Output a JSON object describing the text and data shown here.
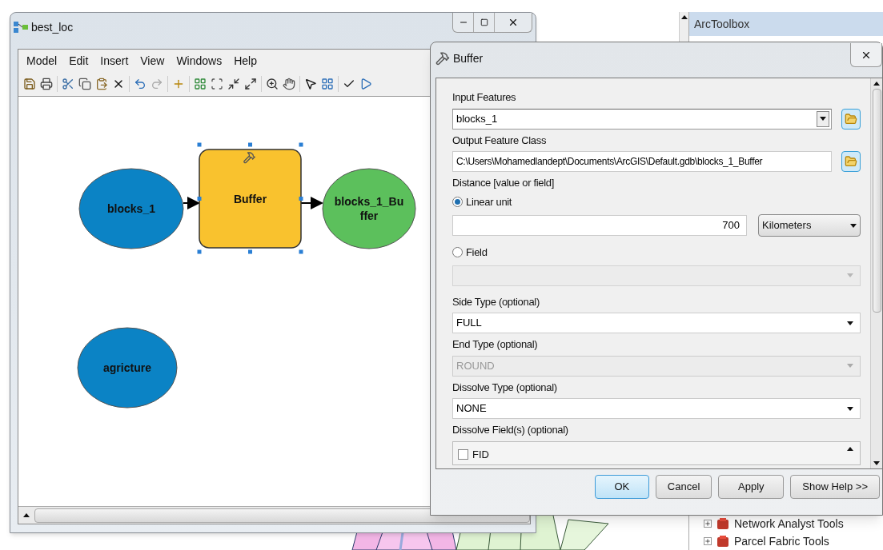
{
  "model_window": {
    "title": "best_loc",
    "menu": [
      "Model",
      "Edit",
      "Insert",
      "View",
      "Windows",
      "Help"
    ],
    "nodes": [
      {
        "kind": "data",
        "label": [
          "blocks_1"
        ],
        "selected": false
      },
      {
        "kind": "tool",
        "label": [
          "Buffer"
        ],
        "selected": true
      },
      {
        "kind": "output",
        "label": [
          "blocks_1_Bu",
          "ffer"
        ],
        "selected": false
      },
      {
        "kind": "data",
        "label": [
          "agricture"
        ],
        "selected": false
      }
    ]
  },
  "dialog": {
    "title": "Buffer",
    "parameters": [
      {
        "label": "Input Features",
        "control": {
          "kind": "combo",
          "value": "blocks_1",
          "browse": true,
          "disabled": false
        }
      },
      {
        "label": "Output Feature Class",
        "control": {
          "kind": "text",
          "value": "C:\\Users\\Mohamedlandept\\Documents\\ArcGIS\\Default.gdb\\blocks_1_Buffer",
          "browse": true,
          "disabled": false
        }
      },
      {
        "label": "Distance [value or field]",
        "options": [
          {
            "label": "Linear unit",
            "selected": true,
            "control": {
              "kind": "number_unit",
              "value": "700",
              "unit": "Kilometers",
              "disabled": false
            }
          },
          {
            "label": "Field",
            "selected": false,
            "control": {
              "kind": "dropdown",
              "disabled": true
            }
          }
        ]
      },
      {
        "label": "Side Type (optional)",
        "control": {
          "kind": "dropdown",
          "value": "FULL",
          "disabled": false
        }
      },
      {
        "label": "End Type (optional)",
        "control": {
          "kind": "dropdown",
          "value": "ROUND",
          "disabled": true
        }
      },
      {
        "label": "Dissolve Type (optional)",
        "control": {
          "kind": "dropdown",
          "value": "NONE",
          "disabled": false
        }
      },
      {
        "label": "Dissolve Field(s) (optional)",
        "control": {
          "kind": "checklist",
          "items": [
            {
              "label": "FID",
              "checked": false
            }
          ]
        }
      }
    ],
    "buttons": [
      {
        "label": "OK",
        "default": true
      },
      {
        "label": "Cancel",
        "default": false
      },
      {
        "label": "Apply",
        "default": false
      },
      {
        "label": "Show Help >>",
        "default": false
      }
    ]
  },
  "toolbox": {
    "title": "ArcToolbox",
    "items": [
      "Network Analyst Tools",
      "Parcel Fabric Tools"
    ]
  }
}
